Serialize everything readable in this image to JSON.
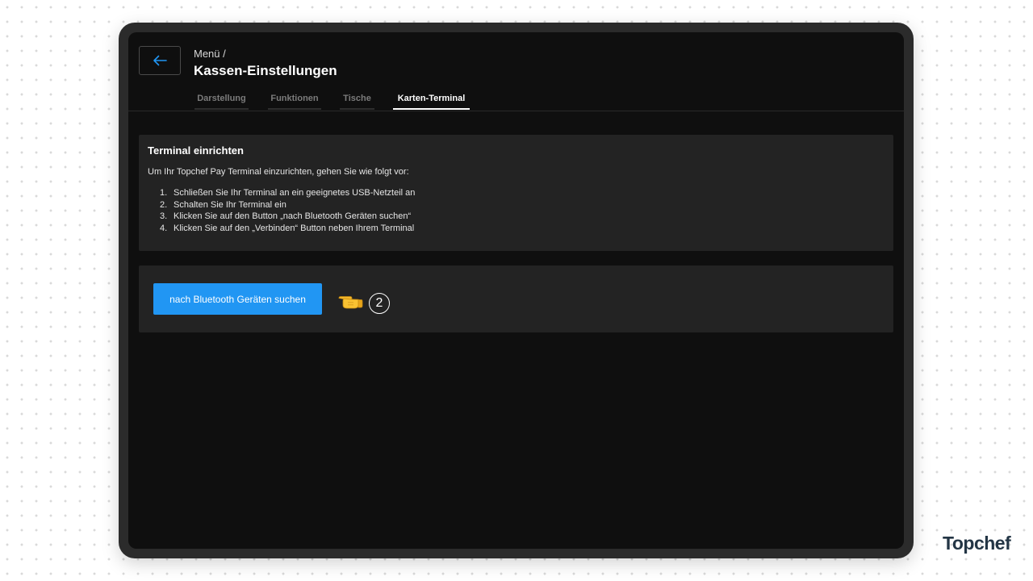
{
  "header": {
    "back_icon": "arrow-left-icon",
    "breadcrumb": "Menü /",
    "title": "Kassen-Einstellungen"
  },
  "tabs": [
    {
      "label": "Darstellung",
      "active": false
    },
    {
      "label": "Funktionen",
      "active": false
    },
    {
      "label": "Tische",
      "active": false
    },
    {
      "label": "Karten-Terminal",
      "active": true
    }
  ],
  "terminal_setup": {
    "title": "Terminal einrichten",
    "intro": "Um Ihr Topchef Pay Terminal einzurichten, gehen Sie wie folgt vor:",
    "steps": [
      {
        "num": "1.",
        "text": "Schließen Sie Ihr Terminal an ein geeignetes USB-Netzteil an"
      },
      {
        "num": "2.",
        "text": "Schalten Sie Ihr Terminal ein"
      },
      {
        "num": "3.",
        "text": "Klicken Sie auf den Button „nach Bluetooth Geräten suchen“"
      },
      {
        "num": "4.",
        "text": "Klicken Sie auf den „Verbinden“ Button neben Ihrem Terminal"
      }
    ]
  },
  "bluetooth": {
    "button_label": "nach Bluetooth Geräten suchen",
    "hint_icon": "pointing-hand-icon",
    "step_badge": "2"
  },
  "brand": {
    "logo_text": "Topchef"
  },
  "colors": {
    "accent": "#2196f3",
    "screen_bg": "#0f0f0f",
    "card_bg": "#232323",
    "brand": "#233545"
  }
}
